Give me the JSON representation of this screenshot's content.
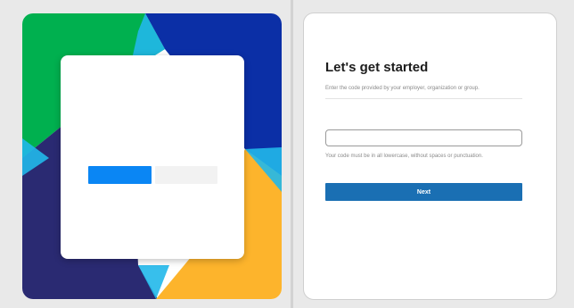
{
  "colors": {
    "page_background": "#e9e9e9",
    "illustration_green": "#00b04f",
    "illustration_navy": "#0b2fa6",
    "illustration_indigo": "#2a2a72",
    "illustration_yellow": "#fdb42c",
    "illustration_cyan": "#21b8ea",
    "mock_primary_blue": "#0a86f4",
    "next_button_blue": "#1a6fb3"
  },
  "form": {
    "title": "Let's get started",
    "subtitle": "Enter the code provided by your employer, organization or group.",
    "code_input": {
      "value": "",
      "placeholder": ""
    },
    "hint": "Your code must be in all lowercase, without spaces or punctuation.",
    "next_label": "Next"
  }
}
